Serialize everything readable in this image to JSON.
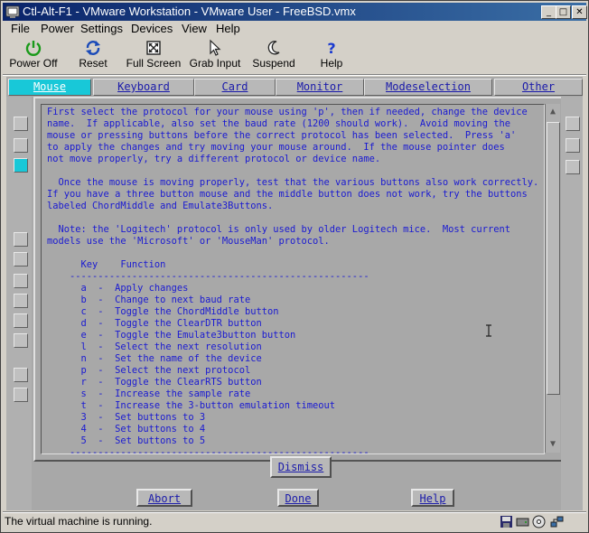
{
  "window": {
    "title": "Ctl-Alt-F1 - VMware Workstation - VMware User - FreeBSD.vmx",
    "minimize_glyph": "_",
    "maximize_glyph": "□",
    "close_glyph": "✕"
  },
  "menu": [
    "File",
    "Power",
    "Settings",
    "Devices",
    "View",
    "Help"
  ],
  "toolbar": [
    {
      "label": "Power Off",
      "icon": "power-icon"
    },
    {
      "label": "Reset",
      "icon": "reset-icon"
    },
    {
      "label": "Full Screen",
      "icon": "fullscreen-icon"
    },
    {
      "label": "Grab Input",
      "icon": "grab-icon"
    },
    {
      "label": "Suspend",
      "icon": "moon-icon"
    },
    {
      "label": "Help",
      "icon": "help-icon"
    }
  ],
  "tabs": [
    "Mouse",
    "Keyboard",
    "Card",
    "Monitor",
    "Modeselection",
    "Other"
  ],
  "active_tab": "Mouse",
  "colors": {
    "accent_tab": "#18c8d8",
    "text_blue": "#1a1ad2",
    "screen_bg": "#a8a8a8"
  },
  "help_text": [
    "First select the protocol for your mouse using 'p', then if needed, change the device",
    "name.  If applicable, also set the baud rate (1200 should work).  Avoid moving the",
    "mouse or pressing buttons before the correct protocol has been selected.  Press 'a'",
    "to apply the changes and try moving your mouse around.  If the mouse pointer does",
    "not move properly, try a different protocol or device name.",
    "",
    "  Once the mouse is moving properly, test that the various buttons also work correctly.",
    "If you have a three button mouse and the middle button does not work, try the buttons",
    "labeled ChordMiddle and Emulate3Buttons.",
    "",
    "  Note: the 'Logitech' protocol is only used by older Logitech mice.  Most current",
    "models use the 'Microsoft' or 'MouseMan' protocol.",
    "",
    "      Key    Function",
    "    -----------------------------------------------------",
    "      a  -  Apply changes",
    "      b  -  Change to next baud rate",
    "      c  -  Toggle the ChordMiddle button",
    "      d  -  Toggle the ClearDTR button",
    "      e  -  Toggle the Emulate3button button",
    "      l  -  Select the next resolution",
    "      n  -  Set the name of the device",
    "      p  -  Select the next protocol",
    "      r  -  Toggle the ClearRTS button",
    "      s  -  Increase the sample rate",
    "      t  -  Increase the 3-button emulation timeout",
    "      3  -  Set buttons to 3",
    "      4  -  Set buttons to 4",
    "      5  -  Set buttons to 5",
    "    -----------------------------------------------------"
  ],
  "scroll_up_glyph": "▲",
  "scroll_down_glyph": "▼",
  "buttons": {
    "dismiss": "Dismiss",
    "abort": "Abort",
    "done": "Done",
    "help": "Help"
  },
  "status": {
    "text": "The virtual machine is running."
  }
}
